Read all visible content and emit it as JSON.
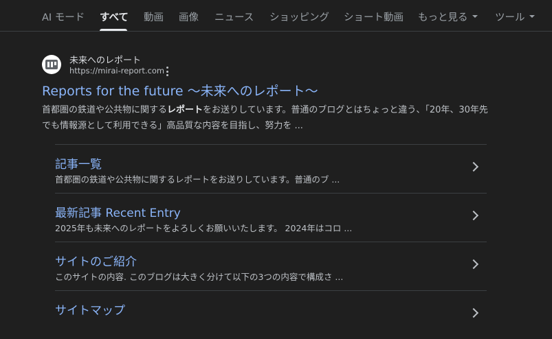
{
  "tabs": [
    {
      "label": "AI モード"
    },
    {
      "label": "すべて"
    },
    {
      "label": "動画"
    },
    {
      "label": "画像"
    },
    {
      "label": "ニュース"
    },
    {
      "label": "ショッピング"
    },
    {
      "label": "ショート動画"
    },
    {
      "label": "もっと見る"
    },
    {
      "label": "ツール"
    }
  ],
  "result": {
    "site_name": "未来へのレポート",
    "url": "https://mirai-report.com",
    "title": "Reports for the future 〜未来へのレポート〜",
    "snippet_before": "首都圏の鉄道や公共物に関する",
    "snippet_bold": "レポート",
    "snippet_after": "をお送りしています。普通のブログとはちょっと違う、「20年、30年先でも情報源として利用できる」高品質な内容を目指し、努力を ..."
  },
  "sitelinks": [
    {
      "title": "記事一覧",
      "desc": "首都圏の鉄道や公共物に関するレポートをお送りしています。普通のブ ..."
    },
    {
      "title": "最新記事 Recent Entry",
      "desc": "2025年も未来へのレポートをよろしくお願いいたします。 2024年はコロ ..."
    },
    {
      "title": "サイトのご紹介",
      "desc": "このサイトの内容. このブログは大きく分けて以下の3つの内容で構成さ ..."
    },
    {
      "title": "サイトマップ",
      "desc": ""
    }
  ],
  "colors": {
    "background": "#1f1f1f",
    "link": "#8ab4f8",
    "text": "#bdc1c6",
    "active_tab": "#e8eaed"
  }
}
